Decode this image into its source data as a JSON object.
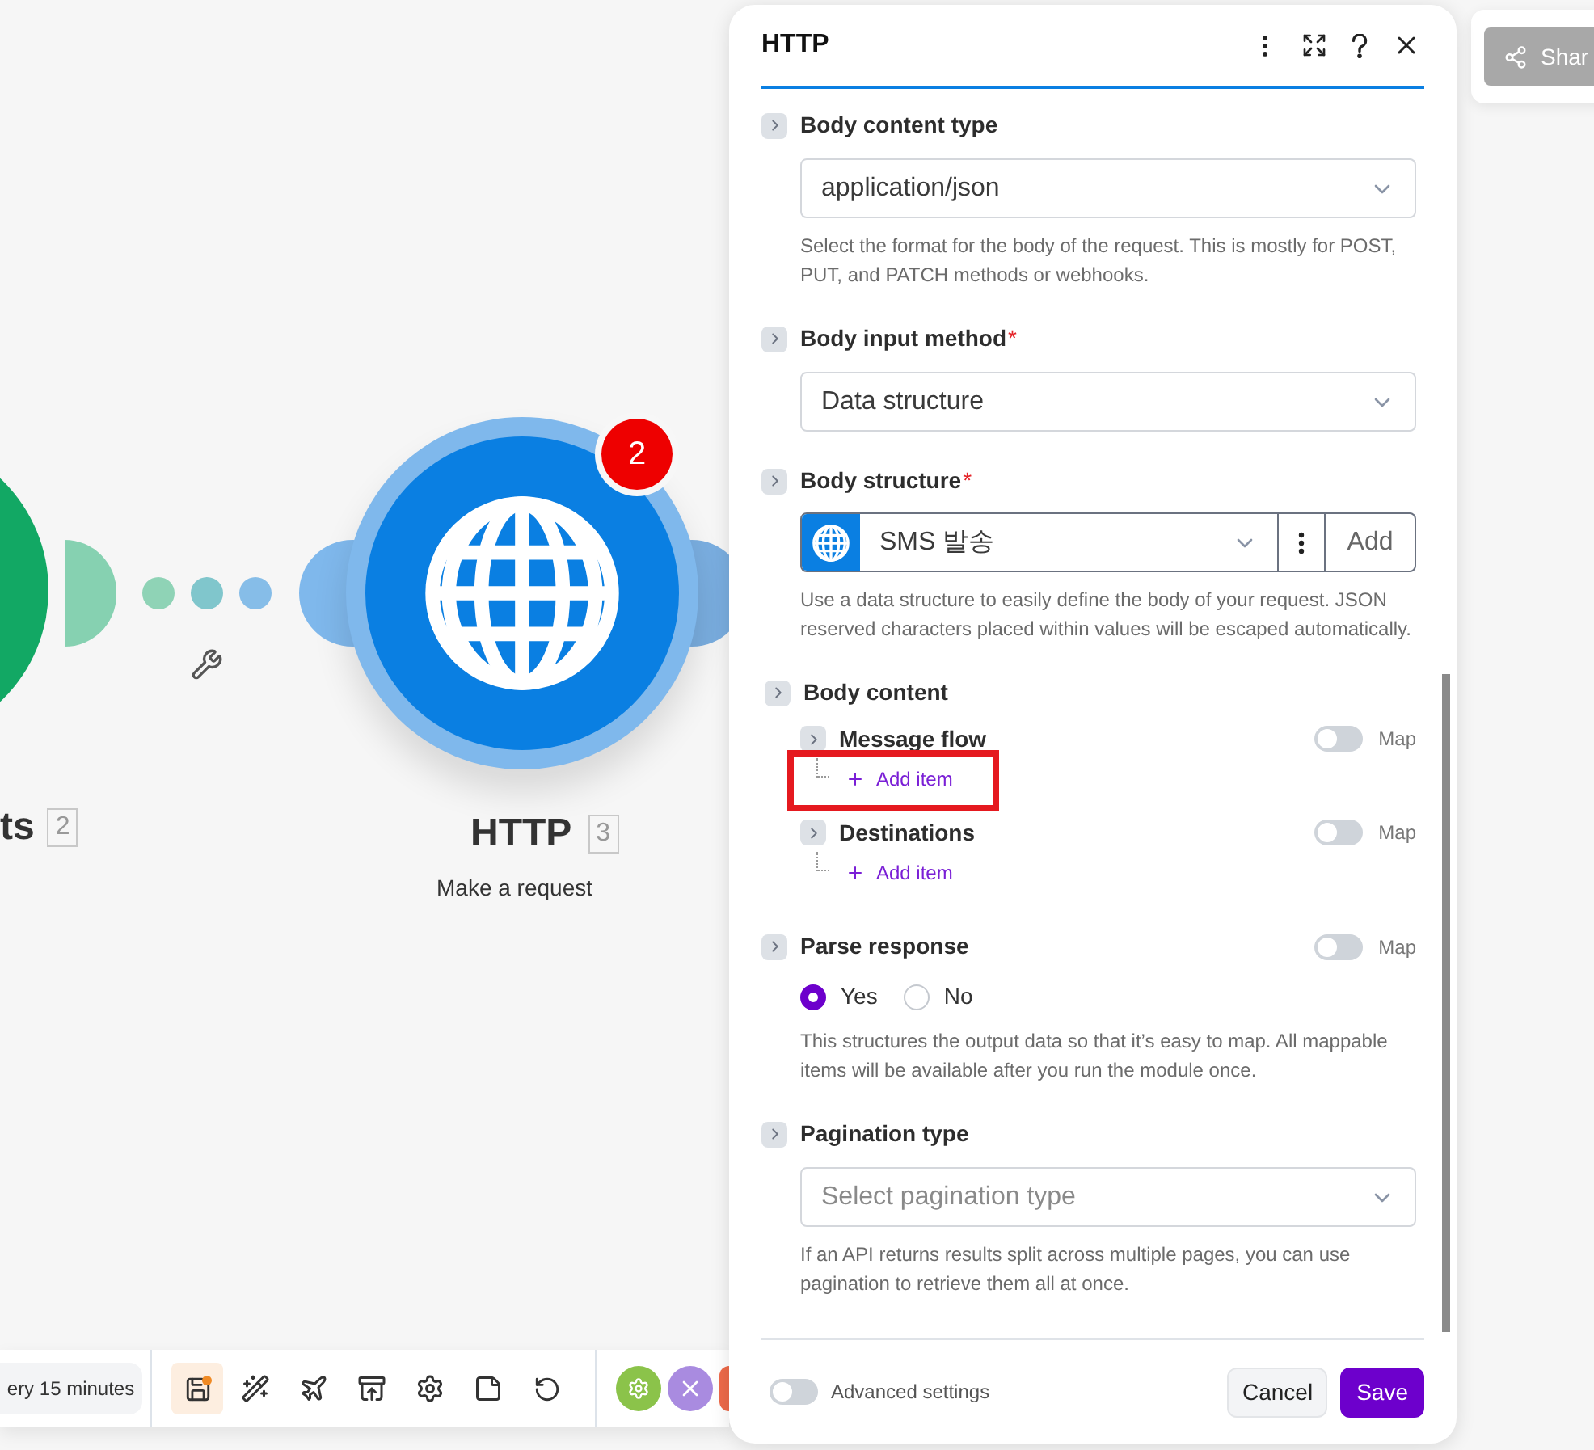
{
  "canvas": {
    "nodes": [
      {
        "kind": "trigger",
        "label": "ts",
        "number": "2"
      },
      {
        "kind": "http",
        "label": "HTTP",
        "number": "3",
        "subtitle": "Make a request",
        "badge": "2"
      }
    ]
  },
  "toolbar": {
    "schedule": "ery 15 minutes",
    "save_unsaved": true
  },
  "share_button": {
    "label": "Shar"
  },
  "panel": {
    "title": "HTTP",
    "fields": [
      {
        "kind": "select",
        "label": "Body content type",
        "value": "application/json",
        "help": "Select the format for the body of the request. This is mostly for POST, PUT, and PATCH methods or webhooks."
      },
      {
        "kind": "select",
        "label": "Body input method",
        "required_mark": "*",
        "value": "Data structure"
      },
      {
        "kind": "structure",
        "label": "Body structure",
        "required_mark": "*",
        "value": "SMS 발송",
        "add": "Add",
        "help": "Use a data structure to easily define the body of your request. JSON reserved characters placed within values will be escaped automatically."
      },
      {
        "kind": "collection",
        "label": "Body content",
        "items": [
          {
            "label": "Message flow",
            "map_label": "Map",
            "map_on": false,
            "add": "Add item",
            "highlighted": true
          },
          {
            "label": "Destinations",
            "map_label": "Map",
            "map_on": false,
            "add": "Add item",
            "highlighted": false
          }
        ]
      },
      {
        "kind": "radio",
        "label": "Parse response",
        "map_label": "Map",
        "map_on": false,
        "options": [
          {
            "label": "Yes",
            "selected": true
          },
          {
            "label": "No",
            "selected": false
          }
        ],
        "help": "This structures the output data so that it’s easy to map. All mappable items will be available after you run the module once."
      },
      {
        "kind": "select",
        "label": "Pagination type",
        "placeholder": "Select pagination type",
        "help": "If an API returns results split across multiple pages, you can use pagination to retrieve them all at once."
      }
    ],
    "advanced": {
      "label": "Advanced settings",
      "on": false
    },
    "cancel": "Cancel",
    "save": "Save"
  }
}
